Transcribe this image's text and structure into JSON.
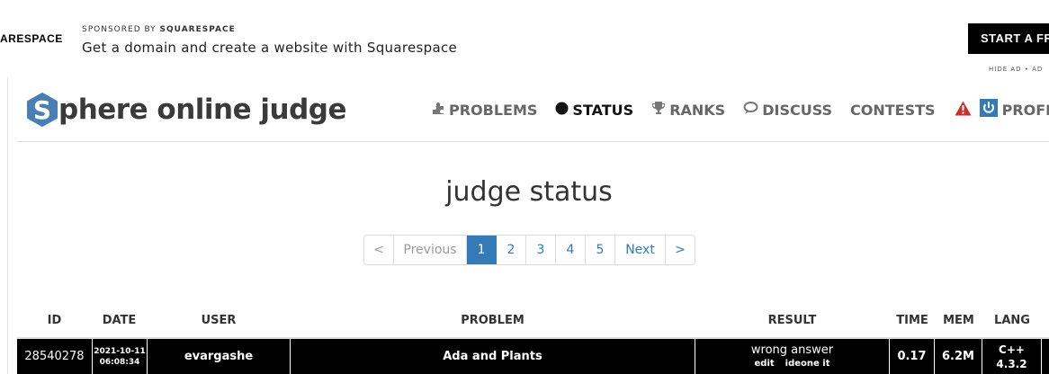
{
  "ad": {
    "logo_text": "ARESPACE",
    "sponsor_prefix": "SPONSORED BY",
    "sponsor_name": "SQUARESPACE",
    "headline": "Get a domain and create a website with Squarespace",
    "cta_label": "START A FR",
    "hide_label": "HIDE AD • AD"
  },
  "site": {
    "logo_letter": "S",
    "logo_text": "phere online judge"
  },
  "nav": {
    "problems": "PROBLEMS",
    "status": "STATUS",
    "ranks": "RANKS",
    "discuss": "DISCUSS",
    "contests": "CONTESTS",
    "profile": "PROFILE"
  },
  "page_title": "judge status",
  "pagination": {
    "first": "<",
    "previous": "Previous",
    "pages": [
      "1",
      "2",
      "3",
      "4",
      "5"
    ],
    "next": "Next",
    "last": ">",
    "current": "1"
  },
  "table": {
    "headers": {
      "id": "ID",
      "date": "DATE",
      "user": "USER",
      "problem": "PROBLEM",
      "result": "RESULT",
      "time": "TIME",
      "mem": "MEM",
      "lang": "LANG"
    },
    "rows": [
      {
        "id": "28540278",
        "date": "2021-10-11",
        "time_of_day": "06:08:34",
        "user": "evargashe",
        "problem": "Ada and Plants",
        "result": "wrong answer",
        "link_edit": "edit",
        "link_ideone": "ideone it",
        "time": "0.17",
        "mem": "6.2M",
        "lang": "C++",
        "lang_version": "4.3.2"
      }
    ]
  },
  "colors": {
    "brand_blue": "#337ab7",
    "logo_blue": "#4a7fb5",
    "warning_red": "#c9302c",
    "row_bg": "#000000"
  }
}
